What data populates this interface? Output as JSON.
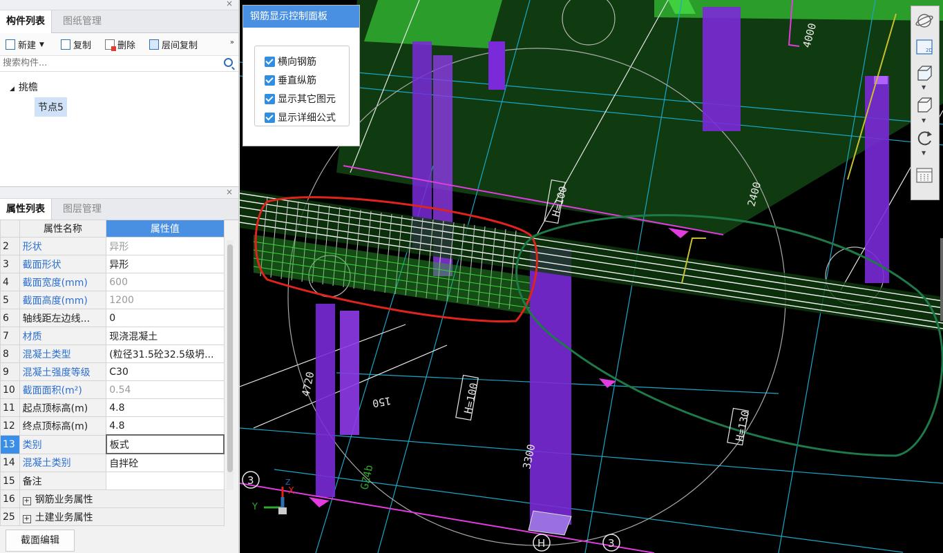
{
  "left_panel": {
    "tabs": [
      "构件列表",
      "图纸管理"
    ],
    "toolbar": {
      "new_label": "新建",
      "copy_label": "复制",
      "delete_label": "删除",
      "floor_copy_label": "层间复制",
      "more_label": "»"
    },
    "search": {
      "placeholder": "搜索构件..."
    },
    "tree": {
      "root": "挑檐",
      "child": "节点5"
    }
  },
  "props_panel": {
    "tabs": [
      "属性列表",
      "图层管理"
    ],
    "header": {
      "name": "属性名称",
      "value": "属性值"
    },
    "rows": [
      {
        "no": "2",
        "name": "形状",
        "value": "异形"
      },
      {
        "no": "3",
        "name": "截面形状",
        "value": "异形"
      },
      {
        "no": "4",
        "name": "截面宽度(mm)",
        "value": "600"
      },
      {
        "no": "5",
        "name": "截面高度(mm)",
        "value": "1200"
      },
      {
        "no": "6",
        "name": "轴线距左边线...",
        "value": "0"
      },
      {
        "no": "7",
        "name": "材质",
        "value": "现浇混凝土"
      },
      {
        "no": "8",
        "name": "混凝土类型",
        "value": "(粒径31.5砼32.5级坍..."
      },
      {
        "no": "9",
        "name": "混凝土强度等级",
        "value": "C30"
      },
      {
        "no": "10",
        "name": "截面面积(m²)",
        "value": "0.54"
      },
      {
        "no": "11",
        "name": "起点顶标高(m)",
        "value": "4.8"
      },
      {
        "no": "12",
        "name": "终点顶标高(m)",
        "value": "4.8"
      },
      {
        "no": "13",
        "name": "类别",
        "value": "板式"
      },
      {
        "no": "14",
        "name": "混凝土类别",
        "value": "自拌砼"
      },
      {
        "no": "15",
        "name": "备注",
        "value": ""
      },
      {
        "no": "16",
        "name": "钢筋业务属性",
        "value": ""
      },
      {
        "no": "25",
        "name": "土建业务属性",
        "value": ""
      }
    ],
    "edit_button": "截面编辑"
  },
  "control_panel": {
    "title": "钢筋显示控制面板",
    "options": [
      "横向钢筋",
      "垂直纵筋",
      "显示其它图元",
      "显示详细公式"
    ]
  },
  "viewport": {
    "labels": [
      "4000",
      "2400",
      "H=100",
      "4720",
      "150",
      "H=100",
      "3300",
      "H=130",
      "GZ4b",
      "3",
      "3",
      "H",
      "X",
      "Y",
      "Z"
    ],
    "view_2d_label": "2D"
  },
  "colors": {
    "accent": "#4a90e2",
    "slab_green": "#2ea82e",
    "column_purple": "#7a2ad8",
    "annotation_red": "#e0241c",
    "annotation_green": "#1f7a4a",
    "magenta": "#e23ce0"
  }
}
